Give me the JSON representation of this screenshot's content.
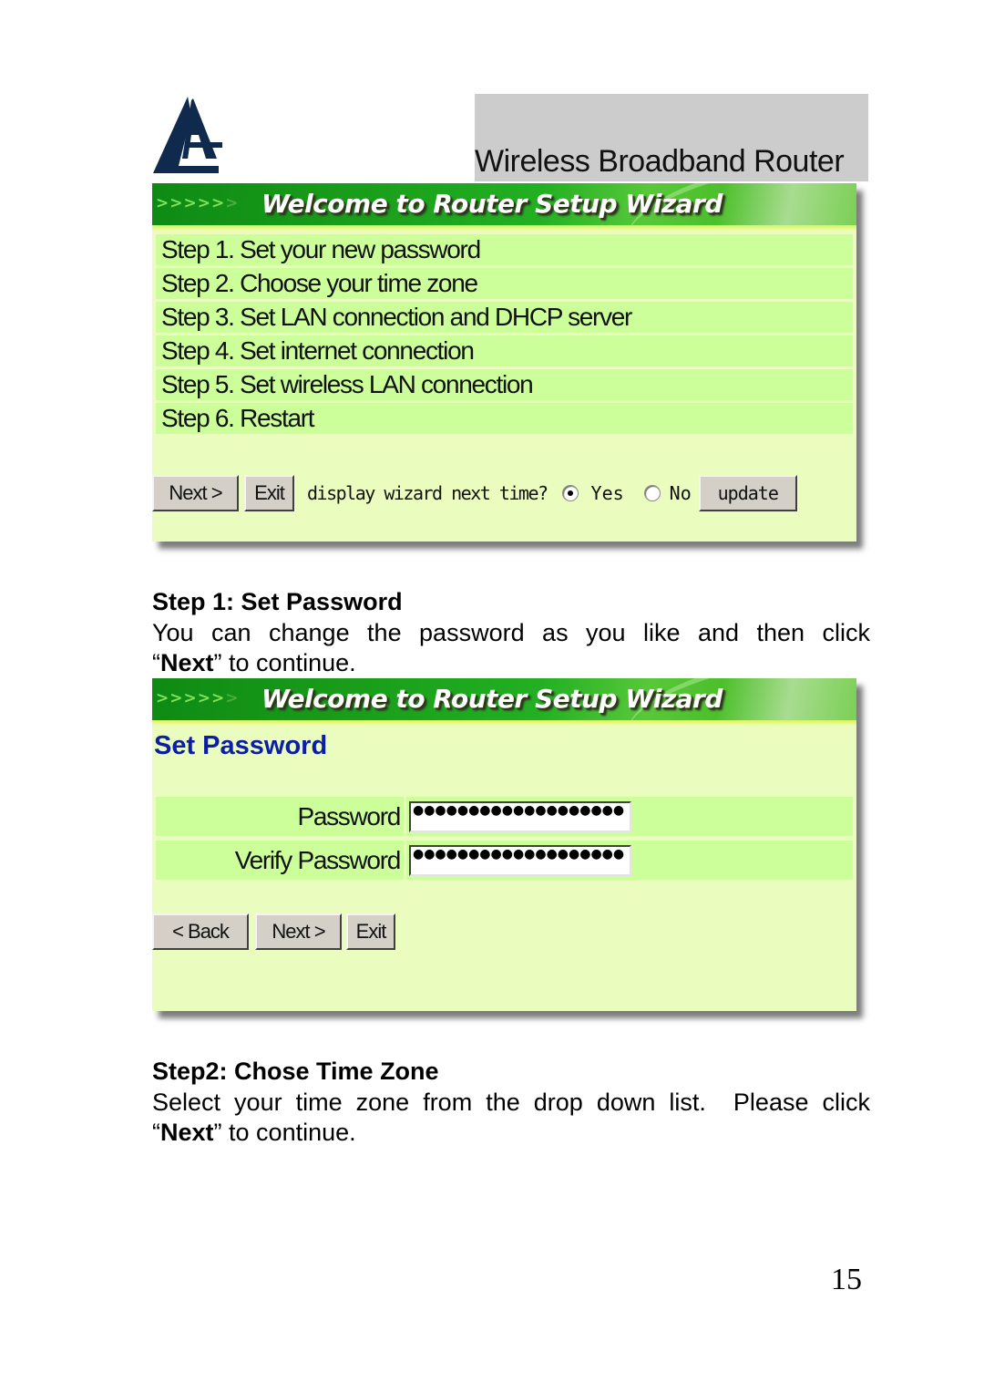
{
  "header": {
    "logo_icon": "atlantis-sail-logo",
    "title": "Wireless Broadband Router"
  },
  "colors": {
    "banner_green": "#1a9e1a",
    "panel_background": "#eafdbe",
    "row_background": "#ccff99",
    "set_password_title": "#0b1ea8",
    "logo_navy": "#0f2a4c",
    "title_box_gray": "#cccccc"
  },
  "wizard_overview": {
    "banner": {
      "arrows": ">>>>>",
      "arrow_faded": ">",
      "title": "Welcome to Router Setup Wizard"
    },
    "steps": [
      "Step 1. Set your new password",
      "Step 2. Choose your time zone",
      "Step 3. Set LAN connection and DHCP server",
      "Step 4. Set internet connection",
      "Step 5. Set wireless LAN connection",
      "Step 6. Restart"
    ],
    "next_label": "Next >",
    "exit_label": "Exit",
    "display_prompt": "display wizard next time?",
    "radio_options": [
      {
        "label": "Yes",
        "selected": true
      },
      {
        "label": "No",
        "selected": false
      }
    ],
    "update_label": "update"
  },
  "section1": {
    "heading": "Step 1: Set Password",
    "paragraph_line1": "You can change the password as you like and then click",
    "quote_open": "“",
    "bold_word": "Next",
    "quote_close": "”",
    "paragraph_rest": " to continue."
  },
  "set_password_panel": {
    "banner": {
      "arrows": ">>>>>",
      "arrow_faded": ">",
      "title": "Welcome to Router Setup Wizard"
    },
    "title": "Set Password",
    "fields": [
      {
        "label": "Password",
        "value": "●●●●●●●●●●●●●●●●●●●"
      },
      {
        "label": "Verify Password",
        "value": "●●●●●●●●●●●●●●●●●●●"
      }
    ],
    "back_label": "< Back",
    "next_label": "Next >",
    "exit_label": "Exit"
  },
  "section2": {
    "heading": "Step2: Chose Time Zone",
    "paragraph_line1": "Select your time zone from the drop down list.  Please click",
    "quote_open": "“",
    "bold_word": "Next",
    "quote_close": "”",
    "paragraph_rest": " to continue."
  },
  "page_number": "15"
}
